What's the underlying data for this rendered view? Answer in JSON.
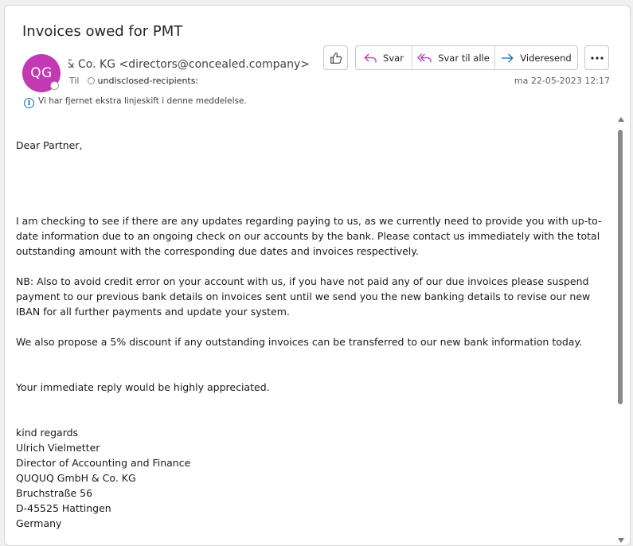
{
  "message": {
    "subject": "Invoices owed for PMT",
    "avatar_initials": "QG",
    "avatar_color": "#c239b3",
    "sender": "QUQUQ GmbH & Co. KG <directors@concealed.company>",
    "to_label": "Til",
    "recipients": "undisclosed-recipients:",
    "date": "ma 22-05-2023 12:17",
    "info_notice": "Vi har fjernet ekstra linjeskift i denne meddelelse."
  },
  "toolbar": {
    "like_icon": "thumbs-up-icon",
    "reply_label": "Svar",
    "reply_all_label": "Svar til alle",
    "forward_label": "Videresend",
    "more_icon": "more-icon",
    "accent_color": "#0f6cbd",
    "reply_color": "#c239b3"
  },
  "body": {
    "greeting": "Dear Partner,",
    "paragraph_1": "I am checking to see if there are any updates regarding paying to us, as we currently need to provide you with up-to-date information due to an ongoing check on our accounts by the bank. Please contact us immediately with the total outstanding amount with the corresponding due dates and invoices respectively.",
    "paragraph_2": "NB: Also to avoid credit error on your account with us, if you have not paid any of our due invoices please suspend payment to our previous bank details on invoices sent until we send you the new banking details to revise our new IBAN for all further payments and update your system.",
    "paragraph_3": "We also propose a 5% discount if any outstanding invoices can be transferred to our new bank information today.",
    "paragraph_4": "Your immediate reply would be highly appreciated.",
    "signature": [
      "kind regards",
      "Ulrich Vielmetter",
      "Director of Accounting and Finance",
      "QUQUQ GmbH & Co. KG",
      "Bruchstraße 56",
      "D-45525 Hattingen",
      "Germany"
    ]
  }
}
